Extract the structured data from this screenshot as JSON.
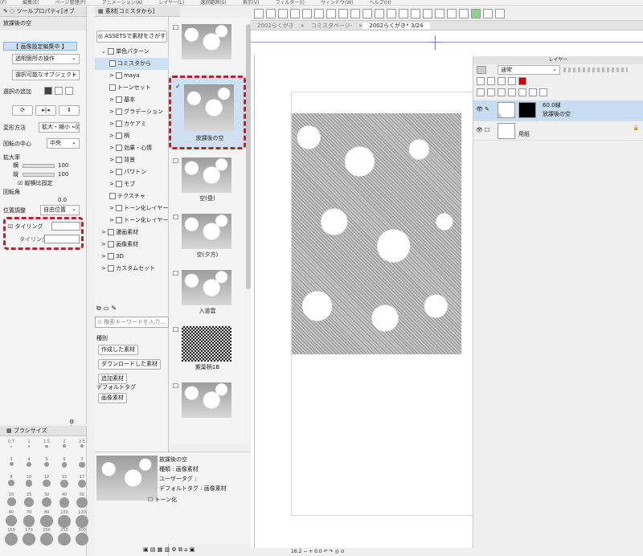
{
  "menubar": {
    "items": [
      "(F)",
      "編集(E)",
      "ページ管理(P)",
      "アニメーション(A)",
      "レイヤー(L)",
      "選択範囲(S)",
      "表示(V)",
      "フィルター(I)",
      "ウィンドウ(W)",
      "ヘルプ(H)"
    ]
  },
  "tool_property": {
    "tab_label": "ツールプロパティ[オブ",
    "title": "放課後の空",
    "section_header": "【 画像設定編集中 】",
    "transparent_op": "透明箇所の操作",
    "selectable_obj": "選択可能なオブジェクト",
    "selection_add_label": "選択の追加",
    "transform_method_label": "変形方法",
    "transform_method_value": "拡大・縮小・回",
    "rotation_center_label": "回転の中心",
    "rotation_center_value": "中央",
    "scale_label": "拡大率",
    "width_label": "横",
    "width_value": "100",
    "height_label": "縦",
    "height_value": "100",
    "keep_ratio_label": "縦横比固定",
    "rotation_label": "回転角",
    "rotation_value": "0.0",
    "position_label": "位置調整",
    "position_value": "自由位置",
    "tiling_label": "タイリング",
    "tiling_dir_label": "タイリング方"
  },
  "brush_size": {
    "tab_label": "ブラシサイズ",
    "sizes": [
      "0.7",
      "1",
      "1.5",
      "2",
      "2.5",
      "3",
      "4",
      "5",
      "6",
      "7",
      "8",
      "10",
      "12",
      "15",
      "17",
      "20",
      "25",
      "30",
      "40",
      "50",
      "60",
      "70",
      "80",
      "100",
      "120",
      "150",
      "170",
      "200",
      "250",
      "300"
    ]
  },
  "material": {
    "tab_label": "素材[コミスタから]",
    "assets_button": "ASSETSで素材をさがす",
    "tree": [
      {
        "label": "単色パターン",
        "indent": 0,
        "arrow": "⌄"
      },
      {
        "label": "コミスタから",
        "indent": 1,
        "arrow": "",
        "selected": true
      },
      {
        "label": "maya",
        "indent": 1,
        "arrow": ">"
      },
      {
        "label": "トーンセット",
        "indent": 1,
        "arrow": ""
      },
      {
        "label": "基本",
        "indent": 1,
        "arrow": ">"
      },
      {
        "label": "グラデーション",
        "indent": 1,
        "arrow": ">"
      },
      {
        "label": "カケアミ",
        "indent": 1,
        "arrow": ">"
      },
      {
        "label": "柄",
        "indent": 1,
        "arrow": ">"
      },
      {
        "label": "効果・心情",
        "indent": 1,
        "arrow": ">"
      },
      {
        "label": "背景",
        "indent": 1,
        "arrow": ">"
      },
      {
        "label": "パワトン",
        "indent": 1,
        "arrow": ">"
      },
      {
        "label": "モブ",
        "indent": 1,
        "arrow": ">"
      },
      {
        "label": "テクスチャ",
        "indent": 1,
        "arrow": ""
      },
      {
        "label": "トーン化レイヤー",
        "indent": 1,
        "arrow": ">"
      },
      {
        "label": "トーン化レイヤー",
        "indent": 1,
        "arrow": ">"
      },
      {
        "label": "漫画素材",
        "indent": 0,
        "arrow": ">"
      },
      {
        "label": "画像素材",
        "indent": 0,
        "arrow": ">"
      },
      {
        "label": "3D",
        "indent": 0,
        "arrow": ">"
      },
      {
        "label": "カスタムセット",
        "indent": 0,
        "arrow": ">"
      }
    ],
    "search_placeholder": "検索キーワードを入力...",
    "tags_header": "種別",
    "tags": [
      "作成した素材",
      "ダウンロードした素材",
      "追加素材"
    ],
    "default_tags_header": "デフォルトタグ",
    "default_tags": [
      "画像素材"
    ],
    "thumbnails": [
      {
        "name": "",
        "checked": false
      },
      {
        "name": "放課後の空",
        "checked": true,
        "selected": true
      },
      {
        "name": "空(昼)",
        "checked": false
      },
      {
        "name": "空(夕方)",
        "checked": false
      },
      {
        "name": "入道雲",
        "checked": false
      },
      {
        "name": "紫葉柄1B",
        "checked": false
      },
      {
        "name": "",
        "checked": false
      }
    ],
    "detail": {
      "name": "放課後の空",
      "type": "種類 : 画像素材",
      "user_tag": "ユーザータグ :",
      "default_tag": "デフォルトタグ : 画像素材",
      "tone": "トーン化"
    }
  },
  "canvas": {
    "tabs": [
      "2002らくがき",
      "コミスタページ-",
      "2002らくがき* 3/24"
    ],
    "zoom_value": "16.2",
    "angle_value": "0.0"
  },
  "layers": {
    "title": "レイヤー",
    "blend_mode": "通常",
    "items": [
      {
        "percent": "60.0線",
        "name": "放課後の空",
        "selected": true
      },
      {
        "percent": "",
        "name": "用紙",
        "selected": false
      }
    ]
  }
}
